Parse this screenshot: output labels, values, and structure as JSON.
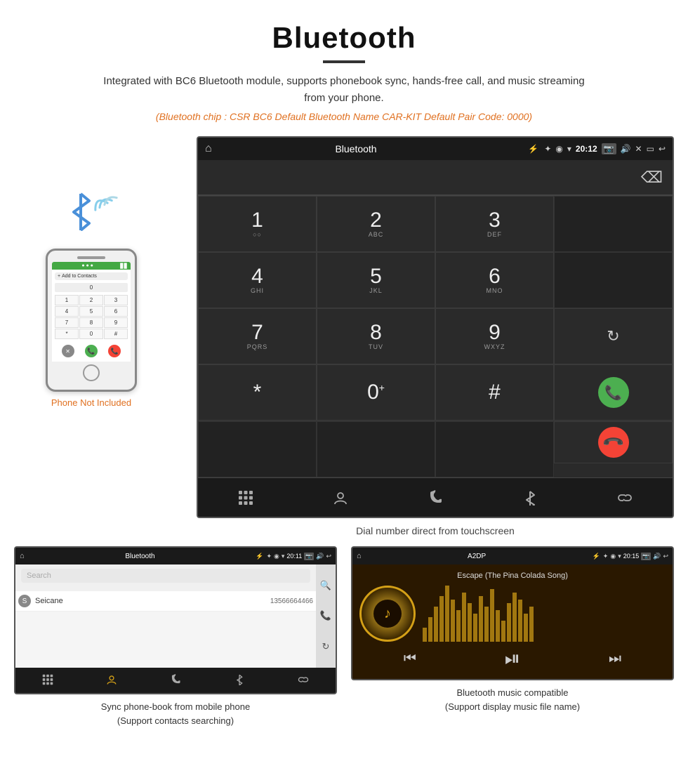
{
  "header": {
    "title": "Bluetooth",
    "description": "Integrated with BC6 Bluetooth module, supports phonebook sync, hands-free call, and music streaming from your phone.",
    "specs": "(Bluetooth chip : CSR BC6    Default Bluetooth Name CAR-KIT    Default Pair Code: 0000)"
  },
  "phone_label": "Phone Not Included",
  "dial_screen": {
    "app_title": "Bluetooth",
    "time": "20:12",
    "keys": [
      {
        "main": "1",
        "sub": ""
      },
      {
        "main": "2",
        "sub": "ABC"
      },
      {
        "main": "3",
        "sub": "DEF"
      },
      {
        "main": "",
        "sub": ""
      },
      {
        "main": "4",
        "sub": "GHI"
      },
      {
        "main": "5",
        "sub": "JKL"
      },
      {
        "main": "6",
        "sub": "MNO"
      },
      {
        "main": "",
        "sub": ""
      },
      {
        "main": "7",
        "sub": "PQRS"
      },
      {
        "main": "8",
        "sub": "TUV"
      },
      {
        "main": "9",
        "sub": "WXYZ"
      },
      {
        "main": "",
        "sub": ""
      },
      {
        "main": "*",
        "sub": ""
      },
      {
        "main": "0",
        "sub": "+"
      },
      {
        "main": "#",
        "sub": ""
      },
      {
        "main": "",
        "sub": ""
      }
    ]
  },
  "dial_caption": "Dial number direct from touchscreen",
  "phonebook_screen": {
    "app_title": "Bluetooth",
    "time": "20:11",
    "search_placeholder": "Search",
    "contact_name": "Seicane",
    "contact_phone": "13566664466",
    "contact_letter": "S"
  },
  "phonebook_caption": "Sync phone-book from mobile phone\n(Support contacts searching)",
  "music_screen": {
    "app_title": "A2DP",
    "time": "20:15",
    "song_title": "Escape (The Pina Colada Song)"
  },
  "music_caption": "Bluetooth music compatible\n(Support display music file name)",
  "nav": {
    "dialpad_icon": "⊞",
    "contacts_icon": "👤",
    "phone_icon": "📞",
    "bluetooth_icon": "⚡",
    "link_icon": "🔗"
  },
  "viz_heights": [
    20,
    35,
    50,
    65,
    80,
    60,
    45,
    70,
    55,
    40,
    65,
    50,
    75,
    45,
    30,
    55,
    70,
    60,
    40,
    50
  ]
}
